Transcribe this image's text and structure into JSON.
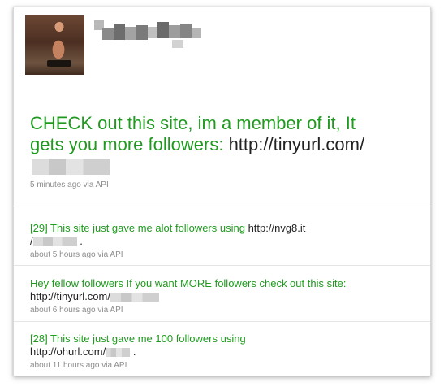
{
  "profile": {
    "avatar_icon": "profile-photo"
  },
  "main_tweet": {
    "text": "CHECK out this site, im a member of it, It gets you more followers:",
    "url": "http://tinyurl.com/",
    "meta": "5 minutes ago via API"
  },
  "tweets": [
    {
      "text": "[29] This site just gave me alot followers using",
      "url_part1": "http://nvg8.it",
      "url_part2": "/",
      "suffix": ".",
      "meta": "about 5 hours ago via API"
    },
    {
      "text": "Hey fellow followers If you want MORE followers check out this site:",
      "url": "http://tinyurl.com/",
      "meta": "about 6 hours ago via API"
    },
    {
      "text": "[28] This site just gave me 100 followers using",
      "url": "http://ohurl.com/",
      "suffix": ".",
      "meta": "about 11 hours ago via API"
    }
  ],
  "colors": {
    "tweet_text": "#1f9a1f",
    "url_text": "#222222",
    "meta_text": "#8c8c8c"
  }
}
